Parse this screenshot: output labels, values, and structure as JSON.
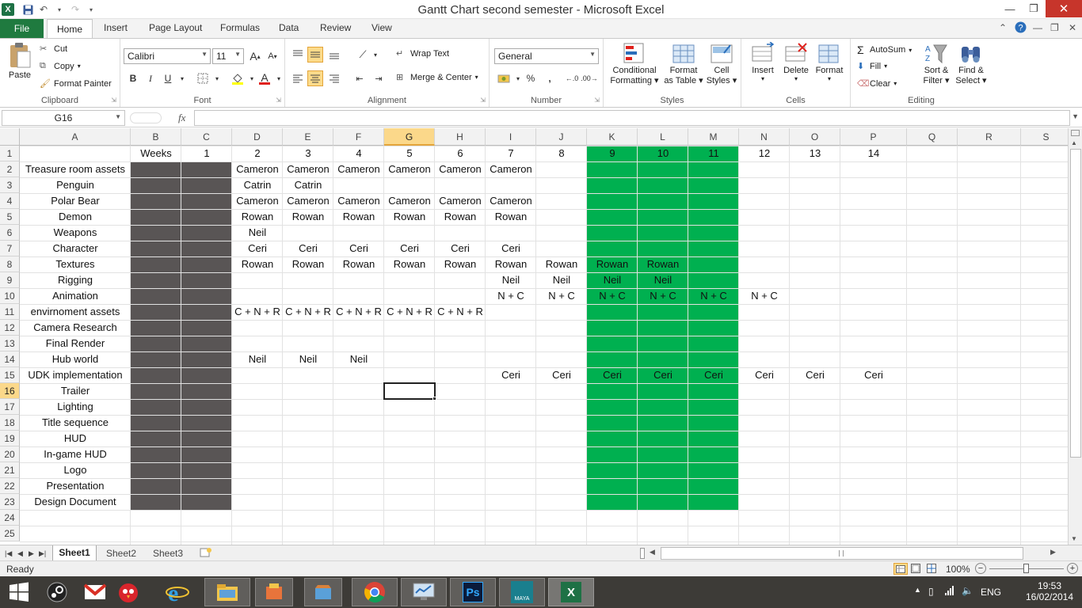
{
  "window": {
    "title": "Gantt Chart second semester  -  Microsoft Excel",
    "minimize_icon": "minimize-icon",
    "restore_icon": "restore-icon",
    "close_icon": "close-icon"
  },
  "ribbon_tabs": {
    "file": "File",
    "home": "Home",
    "insert": "Insert",
    "page_layout": "Page Layout",
    "formulas": "Formulas",
    "data": "Data",
    "review": "Review",
    "view": "View"
  },
  "clipboard": {
    "label": "Clipboard",
    "paste": "Paste",
    "cut": "Cut",
    "copy": "Copy",
    "format_painter": "Format Painter"
  },
  "font": {
    "label": "Font",
    "family": "Calibri",
    "size": "11",
    "bold": "B",
    "italic": "I",
    "underline": "U"
  },
  "alignment": {
    "label": "Alignment",
    "wrap_text": "Wrap Text",
    "merge_center": "Merge & Center"
  },
  "number": {
    "label": "Number",
    "format": "General",
    "percent": "%",
    "comma": ","
  },
  "styles": {
    "label": "Styles",
    "conditional_1": "Conditional",
    "conditional_2": "Formatting",
    "format_table_1": "Format",
    "format_table_2": "as Table",
    "cell_styles_1": "Cell",
    "cell_styles_2": "Styles"
  },
  "cells": {
    "label": "Cells",
    "insert": "Insert",
    "delete": "Delete",
    "format": "Format"
  },
  "editing": {
    "label": "Editing",
    "autosum": "AutoSum",
    "fill": "Fill",
    "clear": "Clear",
    "sort_1": "Sort &",
    "sort_2": "Filter",
    "find_1": "Find &",
    "find_2": "Select"
  },
  "formula_bar": {
    "name_box": "G16",
    "fx": "fx",
    "content": ""
  },
  "sheet": {
    "columns": [
      "A",
      "B",
      "C",
      "D",
      "E",
      "F",
      "G",
      "H",
      "I",
      "J",
      "K",
      "L",
      "M",
      "N",
      "O",
      "P",
      "Q",
      "R",
      "S"
    ],
    "rows": [
      "1",
      "2",
      "3",
      "4",
      "5",
      "6",
      "7",
      "8",
      "9",
      "10",
      "11",
      "12",
      "13",
      "14",
      "15",
      "16",
      "17",
      "18",
      "19",
      "20",
      "21",
      "22",
      "23",
      "24",
      "25"
    ],
    "selected_cell": "G16",
    "fill_colors": {
      "gray": "#595555",
      "green": "#00b050"
    },
    "header_row": [
      "",
      "Weeks",
      "1",
      "2",
      "3",
      "4",
      "5",
      "6",
      "7",
      "8",
      "9",
      "10",
      "11",
      "12",
      "13",
      "14"
    ],
    "tasks": [
      {
        "name": "Treasure room assets",
        "cells": {
          "D": "Cameron",
          "E": "Cameron",
          "F": "Cameron",
          "G": "Cameron",
          "H": "Cameron",
          "I": "Cameron"
        }
      },
      {
        "name": "Penguin",
        "cells": {
          "D": "Catrin",
          "E": "Catrin"
        }
      },
      {
        "name": "Polar Bear",
        "cells": {
          "D": "Cameron",
          "E": "Cameron",
          "F": "Cameron",
          "G": "Cameron",
          "H": "Cameron",
          "I": "Cameron"
        }
      },
      {
        "name": "Demon",
        "cells": {
          "D": "Rowan",
          "E": "Rowan",
          "F": "Rowan",
          "G": "Rowan",
          "H": "Rowan",
          "I": "Rowan"
        }
      },
      {
        "name": "Weapons",
        "cells": {
          "D": "Neil"
        }
      },
      {
        "name": "Character",
        "cells": {
          "D": "Ceri",
          "E": "Ceri",
          "F": "Ceri",
          "G": "Ceri",
          "H": "Ceri",
          "I": "Ceri"
        }
      },
      {
        "name": "Textures",
        "cells": {
          "D": "Rowan",
          "E": "Rowan",
          "F": "Rowan",
          "G": "Rowan",
          "H": "Rowan",
          "I": "Rowan",
          "J": "Rowan",
          "K": "Rowan",
          "L": "Rowan"
        }
      },
      {
        "name": "Rigging",
        "cells": {
          "I": "Neil",
          "J": "Neil",
          "K": "Neil",
          "L": "Neil"
        }
      },
      {
        "name": "Animation",
        "cells": {
          "I": "N + C",
          "J": "N + C",
          "K": "N + C",
          "L": "N + C",
          "M": "N + C",
          "N": "N + C"
        }
      },
      {
        "name": "envirnoment assets",
        "cells": {
          "D": "C + N + R",
          "E": "C + N + R",
          "F": "C + N + R",
          "G": "C + N + R",
          "H": "C + N + R"
        }
      },
      {
        "name": "Camera Research",
        "cells": {}
      },
      {
        "name": "Final Render",
        "cells": {}
      },
      {
        "name": "Hub world",
        "cells": {
          "D": "Neil",
          "E": "Neil",
          "F": "Neil"
        }
      },
      {
        "name": "UDK implementation",
        "cells": {
          "I": "Ceri",
          "J": "Ceri",
          "K": "Ceri",
          "L": "Ceri",
          "M": "Ceri",
          "N": "Ceri",
          "O": "Ceri",
          "P": "Ceri"
        }
      },
      {
        "name": "Trailer",
        "cells": {}
      },
      {
        "name": "Lighting",
        "cells": {}
      },
      {
        "name": "Title sequence",
        "cells": {}
      },
      {
        "name": "HUD",
        "cells": {}
      },
      {
        "name": "In-game HUD",
        "cells": {}
      },
      {
        "name": "Logo",
        "cells": {}
      },
      {
        "name": "Presentation",
        "cells": {}
      },
      {
        "name": "Design Document",
        "cells": {}
      }
    ]
  },
  "sheet_tabs": [
    "Sheet1",
    "Sheet2",
    "Sheet3"
  ],
  "status": {
    "ready": "Ready",
    "zoom": "100%"
  },
  "taskbar": {
    "apps": [
      "start-icon",
      "steam-icon",
      "gmail-icon",
      "angry-birds-icon",
      "internet-explorer-icon",
      "file-explorer-icon",
      "app-icon",
      "app2-icon",
      "chrome-icon",
      "monitor-icon",
      "photoshop-icon",
      "maya-icon",
      "excel-icon"
    ],
    "photoshop_label": "Ps",
    "maya_label": "MAYA",
    "excel_label": "X",
    "language": "ENG",
    "time": "19:53",
    "date": "16/02/2014"
  }
}
